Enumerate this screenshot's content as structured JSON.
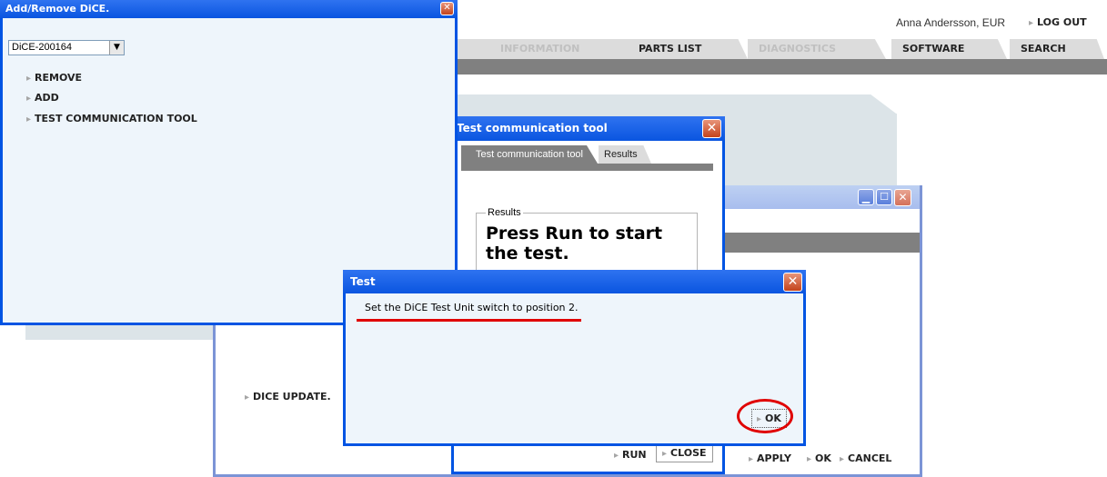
{
  "header": {
    "user": "Anna Andersson, EUR",
    "logout_label": "LOG OUT"
  },
  "nav": {
    "tabs": [
      {
        "label": "INFORMATION",
        "enabled": false
      },
      {
        "label": "PARTS LIST",
        "enabled": true
      },
      {
        "label": "DIAGNOSTICS",
        "enabled": false
      },
      {
        "label": "SOFTWARE",
        "enabled": true
      },
      {
        "label": "SEARCH",
        "enabled": true
      }
    ]
  },
  "add_remove_window": {
    "title": "Add/Remove DiCE.",
    "dropdown_value": "DiCE-200164",
    "actions": [
      "REMOVE",
      "ADD",
      "TEST COMMUNICATION TOOL"
    ]
  },
  "test_comm_window": {
    "title": "Test communication tool",
    "tabs": [
      "Test communication tool",
      "Results"
    ],
    "results_legend": "Results",
    "results_text": "Press Run to start the test.",
    "run_label": "RUN",
    "close_label": "CLOSE"
  },
  "back_window": {
    "dice_update_label": "DICE UPDATE.",
    "apply_label": "APPLY",
    "ok_label": "OK",
    "cancel_label": "CANCEL"
  },
  "test_dialog": {
    "title": "Test",
    "message": "Set the DiCE Test Unit switch to position 2.",
    "ok_label": "OK"
  },
  "colors": {
    "xp_blue": "#0054e3",
    "panel_bg": "#eef5fb",
    "annotation_red": "#e00000",
    "nav_bar": "#808080"
  }
}
